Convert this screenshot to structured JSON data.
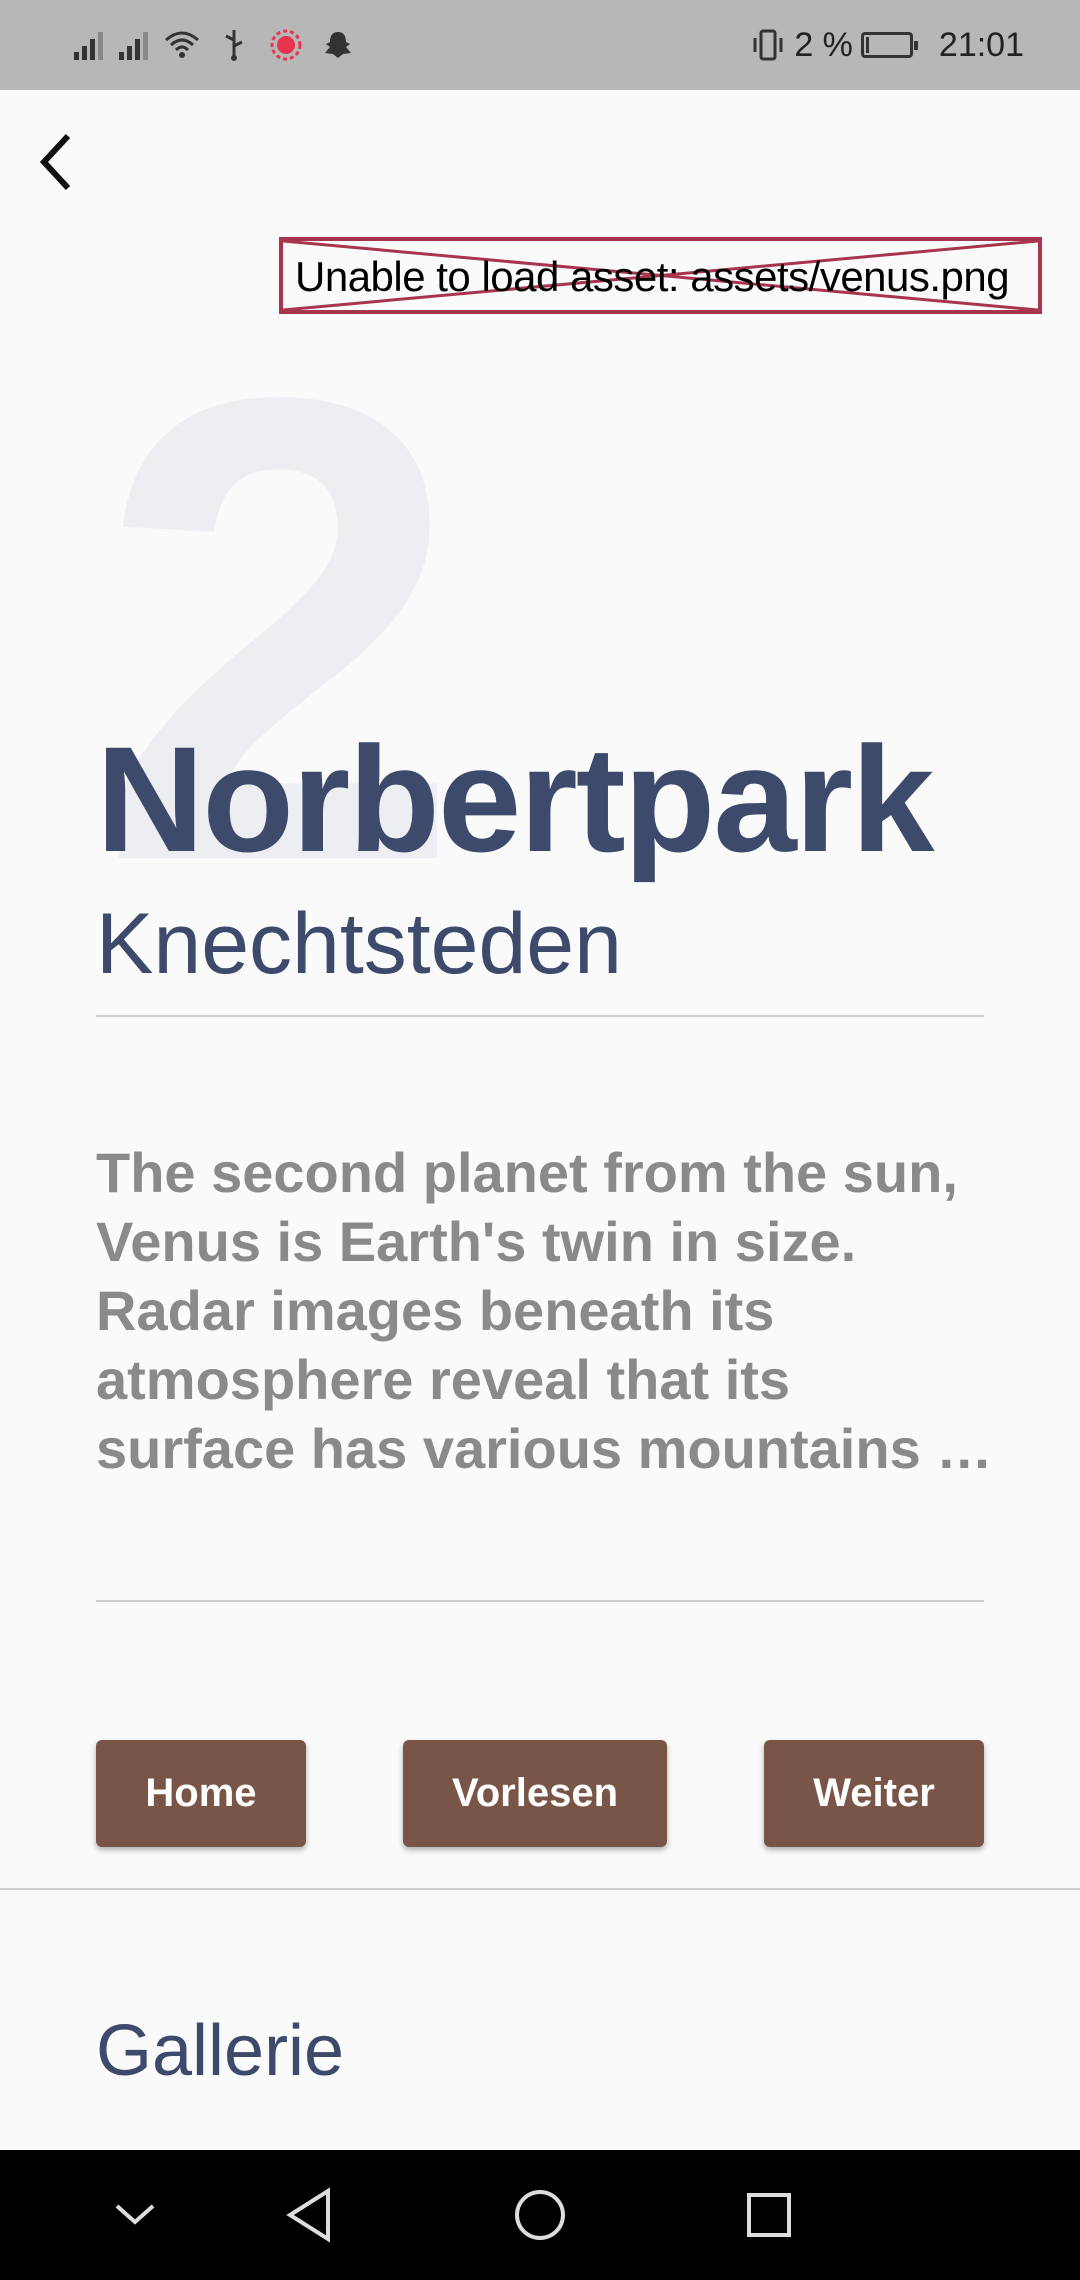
{
  "status_bar": {
    "battery_percent": "2 %",
    "time": "21:01",
    "icons": [
      "signal-icon",
      "signal-icon",
      "wifi-icon",
      "usb-icon",
      "notification-dot-icon",
      "snapchat-icon",
      "vibrate-icon",
      "battery-icon"
    ]
  },
  "header": {
    "back_icon": "chevron-left-icon"
  },
  "asset_error": {
    "message": "Unable to load asset: assets/venus.png"
  },
  "planet": {
    "number": "2",
    "title": "Norbertpark",
    "subtitle": "Knechtsteden",
    "description_lines": [
      "The second planet from the sun,",
      "Venus is Earth's twin in size.",
      "Radar images beneath its",
      "atmosphere reveal that its",
      "surface has various mountains …"
    ]
  },
  "buttons": {
    "home": "Home",
    "read": "Vorlesen",
    "next": "Weiter"
  },
  "gallery": {
    "heading": "Gallerie"
  },
  "colors": {
    "title": "#3e4a6c",
    "button": "#795548",
    "error_border": "#a8344e"
  }
}
